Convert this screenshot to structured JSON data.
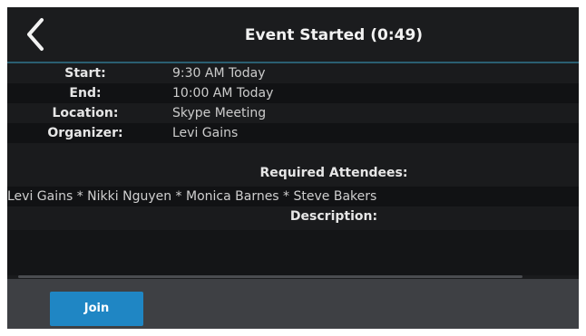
{
  "header": {
    "title": "Event Started (0:49)",
    "back_icon": "chevron-left-icon"
  },
  "details": [
    {
      "label": "Start:",
      "value": "9:30 AM Today"
    },
    {
      "label": "End:",
      "value": "10:00 AM Today"
    },
    {
      "label": "Location:",
      "value": "Skype Meeting"
    },
    {
      "label": "Organizer:",
      "value": "Levi Gains"
    }
  ],
  "attendees": {
    "heading": "Required Attendees:",
    "list": "Levi Gains * Nikki Nguyen * Monica Barnes * Steve Bakers"
  },
  "description": {
    "heading": "Description:"
  },
  "footer": {
    "join_label": "Join"
  },
  "colors": {
    "accent": "#1f86c4",
    "header_border": "#2b5f72",
    "footer_bg": "#3e4044"
  }
}
